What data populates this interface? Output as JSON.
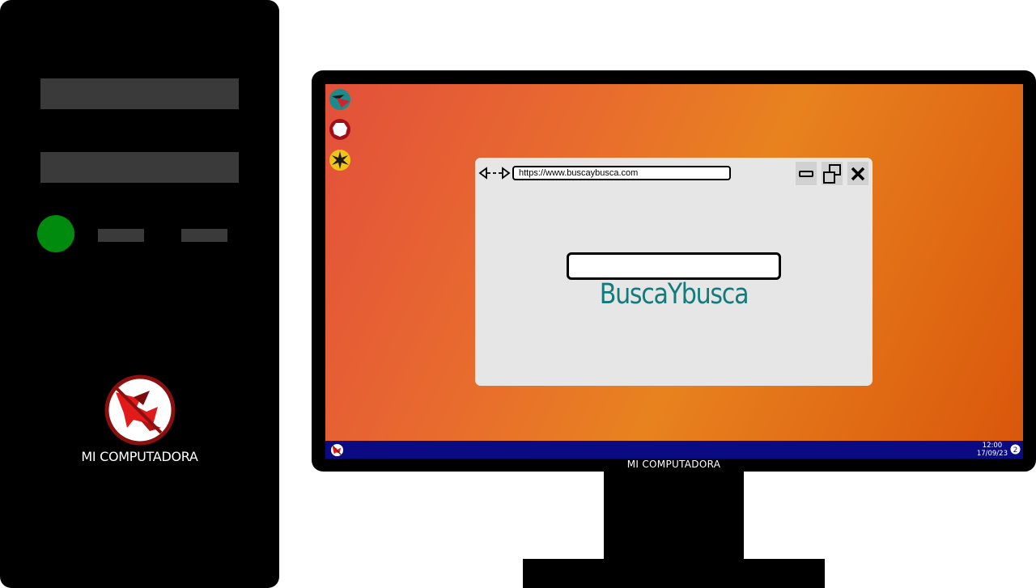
{
  "tower": {
    "brand_label": "MI COMPUTADORA",
    "power_light_color": "#008a0e"
  },
  "monitor": {
    "brand_label": "MI COMPUTADORA"
  },
  "desktop": {
    "icons": [
      "compass-app-icon",
      "octagon-app-icon",
      "star-app-icon"
    ],
    "background_colors": [
      "#e2503b",
      "#e8821f",
      "#d9560b"
    ]
  },
  "browser": {
    "url": "https://www.buscaybusca.com",
    "search_value": "",
    "brand_title": "BuscaYbusca",
    "brand_color": "#147a7a",
    "controls": [
      "minimize-icon",
      "restore-icon",
      "close-icon"
    ]
  },
  "taskbar": {
    "time": "12:00",
    "date": "17/09/23",
    "notification_count": "2",
    "color": "#0a0a82"
  }
}
